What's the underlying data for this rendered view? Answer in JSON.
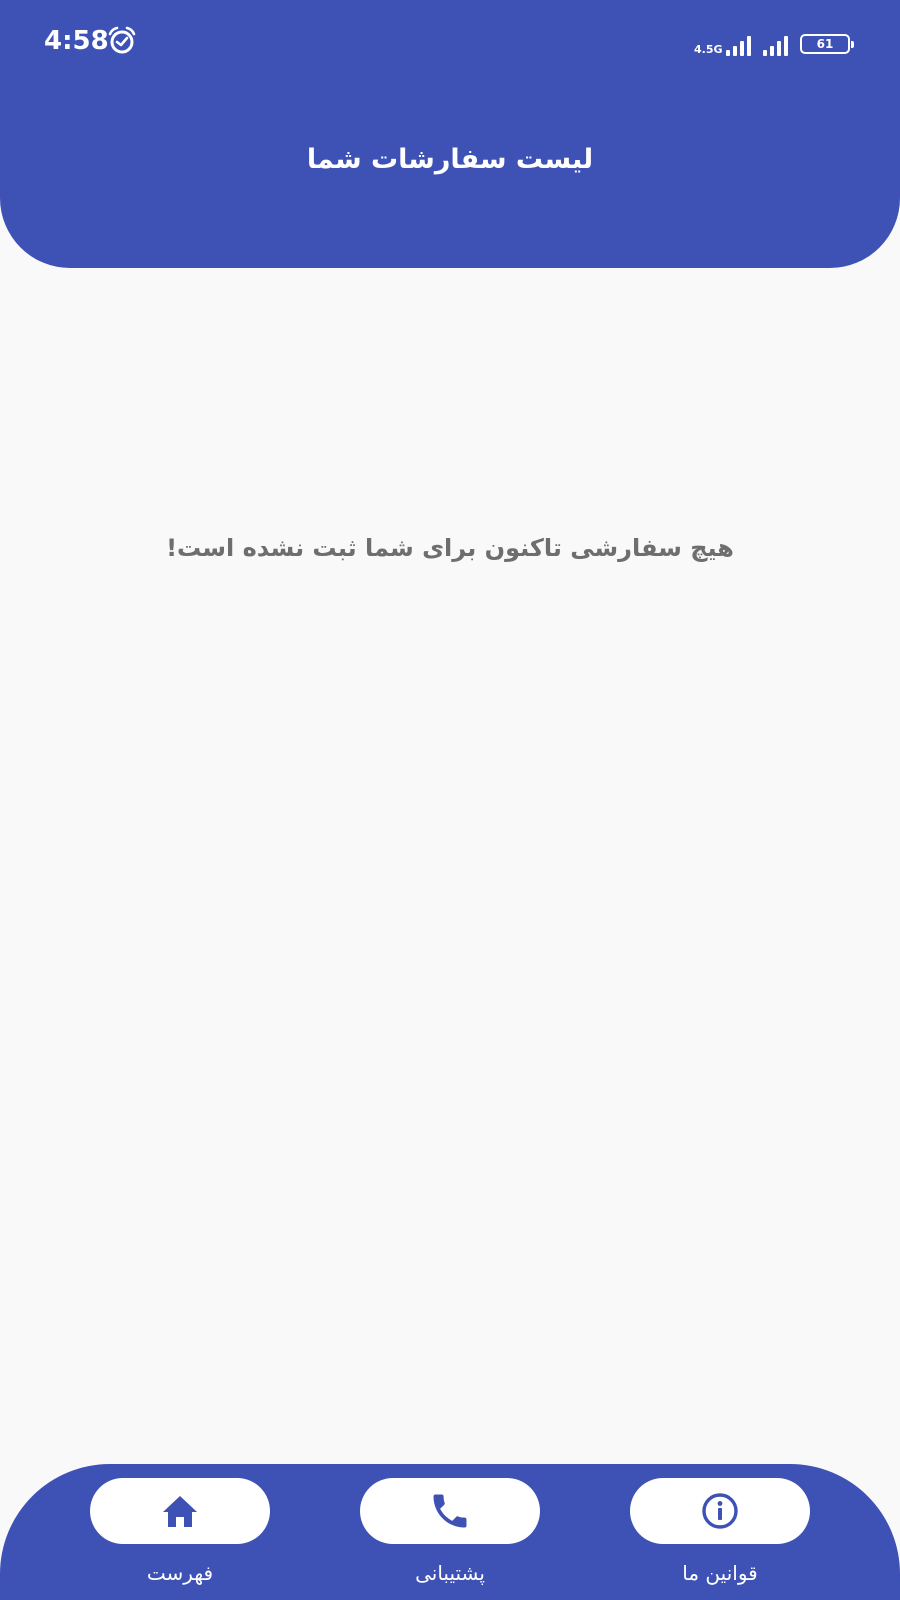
{
  "status_bar": {
    "time": "4:58",
    "alarm_icon": "alarm-clock-icon",
    "network_label": "4.5G",
    "battery_level": "61"
  },
  "header": {
    "title": "لیست سفارشات شما"
  },
  "main": {
    "empty_message": "هیچ سفارشی تاکنون برای شما ثبت نشده است!"
  },
  "bottom_nav": {
    "items": [
      {
        "label": "فهرست",
        "icon": "home-icon"
      },
      {
        "label": "پشتیبانی",
        "icon": "phone-icon"
      },
      {
        "label": "قوانین ما",
        "icon": "info-icon"
      }
    ]
  },
  "colors": {
    "primary": "#3e51b5",
    "background": "#f9f9fa",
    "message_text": "#6e6e6e",
    "white": "#ffffff"
  }
}
